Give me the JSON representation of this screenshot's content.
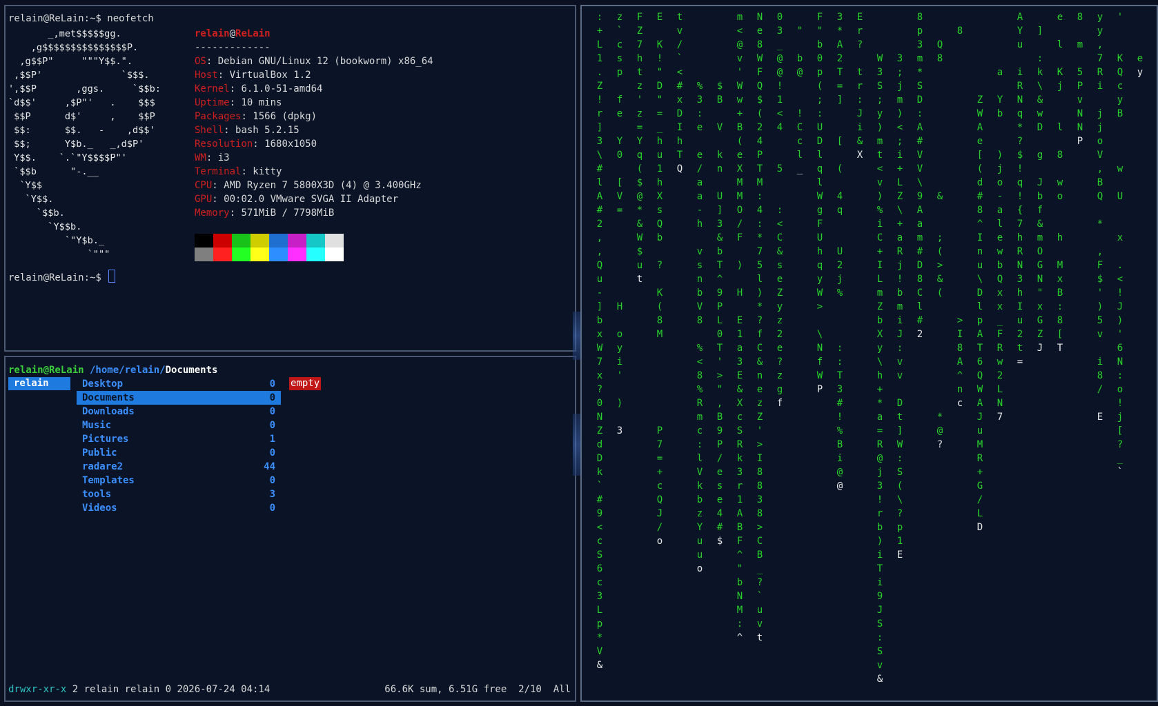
{
  "neofetch": {
    "command_line": "relain@ReLain:~$ neofetch",
    "logo_lines": [
      "       _,met$$$$$gg.",
      "    ,g$$$$$$$$$$$$$$$P.",
      "  ,g$$P\"     \"\"\"Y$$.\".",
      " ,$$P'              `$$$.",
      "',$$P       ,ggs.     `$$b:",
      "`d$$'     ,$P\"'   .    $$$",
      " $$P      d$'     ,    $$P",
      " $$:      $$.   -    ,d$$'",
      " $$;      Y$b._   _,d$P'",
      " Y$$.    `.`\"Y$$$$P\"'",
      " `$$b      \"-.__",
      "  `Y$$",
      "   `Y$$.",
      "     `$$b.",
      "       `Y$$b.",
      "          `\"Y$b._",
      "              `\"\"\""
    ],
    "user": "relain",
    "at": "@",
    "host": "ReLain",
    "separator": "-------------",
    "fields": [
      {
        "key": "OS",
        "value": "Debian GNU/Linux 12 (bookworm) x86_64"
      },
      {
        "key": "Host",
        "value": "VirtualBox 1.2"
      },
      {
        "key": "Kernel",
        "value": "6.1.0-51-amd64"
      },
      {
        "key": "Uptime",
        "value": "10 mins"
      },
      {
        "key": "Packages",
        "value": "1566 (dpkg)"
      },
      {
        "key": "Shell",
        "value": "bash 5.2.15"
      },
      {
        "key": "Resolution",
        "value": "1680x1050"
      },
      {
        "key": "WM",
        "value": "i3"
      },
      {
        "key": "Terminal",
        "value": "kitty"
      },
      {
        "key": "CPU",
        "value": "AMD Ryzen 7 5800X3D (4) @ 3.400GHz"
      },
      {
        "key": "GPU",
        "value": "00:02.0 VMware SVGA II Adapter"
      },
      {
        "key": "Memory",
        "value": "571MiB / 7798MiB"
      }
    ],
    "palette_dark": [
      "#000000",
      "#cd0000",
      "#19c219",
      "#cdcd00",
      "#1e6fd0",
      "#c720c7",
      "#15c7c7",
      "#e0e0e0"
    ],
    "palette_bright": [
      "#7f7f7f",
      "#ff2020",
      "#23ff23",
      "#ffff1a",
      "#2d8fff",
      "#ff30ff",
      "#26ffff",
      "#ffffff"
    ],
    "prompt": "relain@ReLain:~$ "
  },
  "ranger": {
    "user_host": "relain@ReLain",
    "path": " /home/relain/",
    "cwd": "Documents",
    "parent_item": "relain",
    "items": [
      {
        "name": "Desktop",
        "count": "0"
      },
      {
        "name": "Documents",
        "count": "0"
      },
      {
        "name": "Downloads",
        "count": "0"
      },
      {
        "name": "Music",
        "count": "0"
      },
      {
        "name": "Pictures",
        "count": "1"
      },
      {
        "name": "Public",
        "count": "0"
      },
      {
        "name": "radare2",
        "count": "44"
      },
      {
        "name": "Templates",
        "count": "0"
      },
      {
        "name": "tools",
        "count": "3"
      },
      {
        "name": "Videos",
        "count": "0"
      }
    ],
    "selected_index": 1,
    "preview": "empty",
    "status_perm": "drwxr-xr-x",
    "status_info": " 2 relain relain 0 2026-07-24 04:14",
    "status_right": "66.6K sum, 6.51G free  2/10  All"
  },
  "matrix": {
    "columns": [
      ":+L1.Z!r]3\\#lA#2,,Qu-]bxW7x?0NZdDk`#9<cS6c3Lp*V&",
      "z`csp fe Y0 [V=      H oyi' ) 3",
      "FZ7htz'z=Yq($@*&W$ut",
      "E K!\"D\"=_hu1hXsQb ? K(8M      P7=+cQJ/o",
      "tv/`<#xDIhTQ",
      "     %3:e e/aa-h vsnbV8 %<8%Rmc:lVkbzYuuo",
      "     $B V kn U]3&bT^9PL0T'>\",B9P/ese4#$",
      "m<@v'Ww+B(eXMMO/F ) H E1a3E&XcSRk3r1ABF^\"bNM:^",
      "Ne8WFQ$(24PTM:4:*75l)*?fC&nezZ'>I8838>CB_?`uvt",
      "03_@@!1<4  5  :<C&seZyz2e?zgf",
      " \" b@  !Ccl_",
      "F\"b0p(;:UDlqlWgFUhqyW> \\NfWP",
      "3*A2T=]  [ ( 4q  U2j%   ::T3#!%Bi@@",
      "Er? tr:Ji&X",
      "   W3S;y)mt<v)%iC+ILmZbXy\\h+*a=R@j3!rb)iTi9JS:Sv&vCt'qcHD]g!WO:SPq(WM7yt*T\\pLTL[hKySE%OEWd4*l",
      "   3;jm)<;i+LZ\\+aRj!bmiJ:vv Dt]W:S(\\?p1E",
      "8p3m*SD:A#VV\\9Aam#D8Cl#2",
      "  Q8         &  ;(>&(        *@?",
      " 8                    >I8A^nc",
      "      ZWAe[(d#8^Inu\\DlpAT6QWAJuMR+G/LD",
      "    a Yb  )jo-alewbQxx_FRw2LN7",
      "AYu iRNq*?$!q!{7hRN3hIu2t=",
      " ] :k\\&wD g Jbf&mOGN\"xGZJ",
      "e l Kj  l 8 wo  h MxB:8[T",
      "8 m 5PvNNP",
      "yy,7Ri jjoV,BQ * ,F$')5v i8/ E",
      "'  KQcyB   w U  x .<!J)'6N:o!j[?_`",
      "   ey"
    ]
  }
}
